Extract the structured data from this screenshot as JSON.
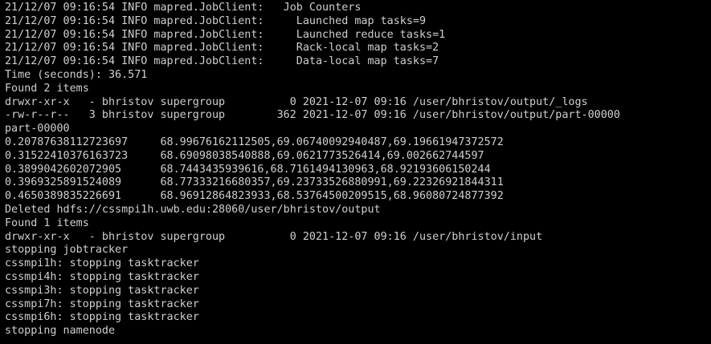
{
  "terminal": {
    "colors": {
      "background": "#000000",
      "foreground": "#cfcfcf"
    },
    "lines": [
      "21/12/07 09:16:54 INFO mapred.JobClient:   Job Counters",
      "21/12/07 09:16:54 INFO mapred.JobClient:     Launched map tasks=9",
      "21/12/07 09:16:54 INFO mapred.JobClient:     Launched reduce tasks=1",
      "21/12/07 09:16:54 INFO mapred.JobClient:     Rack-local map tasks=2",
      "21/12/07 09:16:54 INFO mapred.JobClient:     Data-local map tasks=7",
      "Time (seconds): 36.571",
      "Found 2 items",
      "drwxr-xr-x   - bhristov supergroup          0 2021-12-07 09:16 /user/bhristov/output/_logs",
      "-rw-r--r--   3 bhristov supergroup        362 2021-12-07 09:16 /user/bhristov/output/part-00000",
      "part-00000",
      "0.20787638112723697     68.99676162112505,69.06740092940487,69.19661947372572",
      "0.31522410376163723     68.69098038540888,69.0621773526414,69.002662744597",
      "0.3899042602072905      68.7443435939616,68.7161494130963,68.92193606150244",
      "0.3969325891524089      68.77333216680357,69.23733526880991,69.22326921844311",
      "0.4650389835226691      68.96912864823933,68.53764500209515,68.96080724877392",
      "Deleted hdfs://cssmpi1h.uwb.edu:28060/user/bhristov/output",
      "Found 1 items",
      "drwxr-xr-x   - bhristov supergroup          0 2021-12-07 09:16 /user/bhristov/input",
      "stopping jobtracker",
      "cssmpi1h: stopping tasktracker",
      "cssmpi4h: stopping tasktracker",
      "cssmpi3h: stopping tasktracker",
      "cssmpi7h: stopping tasktracker",
      "cssmpi6h: stopping tasktracker",
      "stopping namenode"
    ]
  }
}
